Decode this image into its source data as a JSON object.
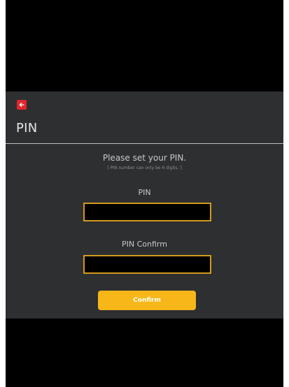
{
  "header": {
    "back_icon": "arrow-left-icon",
    "title": "PIN"
  },
  "prompt": {
    "heading": "Please set your PIN.",
    "note": "[ PIN number can only be 6 digits. ]"
  },
  "pin_field": {
    "label": "PIN",
    "value": ""
  },
  "pin_confirm_field": {
    "label": "PIN Confirm",
    "value": ""
  },
  "actions": {
    "confirm_label": "Confirm"
  },
  "colors": {
    "screen_background": "#000000",
    "dialog_background": "#2d2f31",
    "back_button": "#e2262b",
    "input_border": "#d39a1c",
    "confirm_button": "#f7b718"
  }
}
